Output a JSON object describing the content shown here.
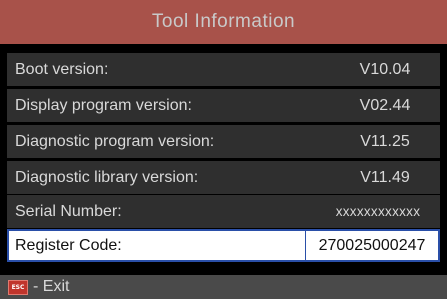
{
  "title": "Tool  Information",
  "rows": [
    {
      "label": "Boot version:",
      "value": "V10.04"
    },
    {
      "label": "Display program version:",
      "value": "V02.44"
    },
    {
      "label": "Diagnostic program version:",
      "value": "V11.25"
    },
    {
      "label": "Diagnostic library version:",
      "value": "V11.49"
    },
    {
      "label": "Serial Number:",
      "value": "xxxxxxxxxxxx"
    },
    {
      "label": "Register Code:",
      "value": "270025000247"
    }
  ],
  "footer": {
    "esc_icon_text": "ESC",
    "exit_label": "- Exit"
  },
  "colors": {
    "title_bar": "#a8524a",
    "row_background": "#2f2f2f",
    "selected_border": "#2a4fa8",
    "footer_background": "#4a4a4a",
    "esc_icon": "#c0352c"
  }
}
